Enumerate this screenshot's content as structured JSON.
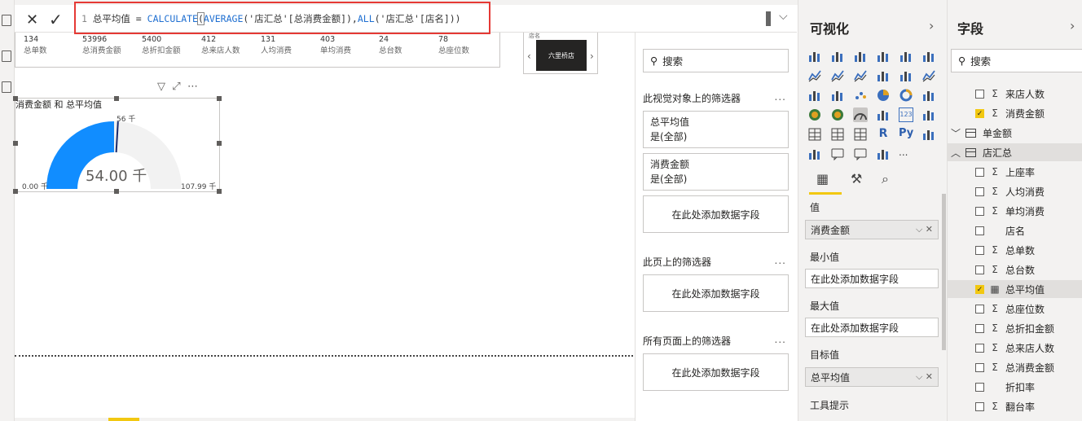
{
  "formula": {
    "line_no": "1",
    "measure": "总平均值 = ",
    "fn1": "CALCULATE",
    "fn2": "AVERAGE",
    "arg1": "('店汇总'[总消费金额]),",
    "fn3": "ALL",
    "arg2": "('店汇总'[店名]))"
  },
  "cards": [
    {
      "value": "134",
      "label": "总单数"
    },
    {
      "value": "53996",
      "label": "总消费金额"
    },
    {
      "value": "5400",
      "label": "总折扣金额"
    },
    {
      "value": "412",
      "label": "总来店人数"
    },
    {
      "value": "131",
      "label": "人均消费"
    },
    {
      "value": "403",
      "label": "单均消费"
    },
    {
      "value": "24",
      "label": "总台数"
    },
    {
      "value": "78",
      "label": "总座位数"
    }
  ],
  "slicer": {
    "caption": "店名",
    "value": "六里桥店"
  },
  "gauge": {
    "title": "消费金额 和 总平均值",
    "value_label": "54.00 千",
    "min_label": "0.00 千",
    "max_label": "107.99 千",
    "target_label": "56 千",
    "value": 54.0,
    "min": 0,
    "max": 107.99,
    "target": 56,
    "fill_color": "#118DFF",
    "track_color": "#F2F2F2"
  },
  "filters_pane": {
    "search_placeholder": "搜索",
    "section_visual": "此视觉对象上的筛选器",
    "more": "...",
    "filter1": {
      "name": "总平均值",
      "state": "是(全部)"
    },
    "filter2": {
      "name": "消费金额",
      "state": "是(全部)"
    },
    "drop_text": "在此处添加数据字段",
    "section_page": "此页上的筛选器",
    "section_all": "所有页面上的筛选器"
  },
  "viz_pane": {
    "title": "可视化",
    "more": "...",
    "value_label": "值",
    "value_field": "消费金额",
    "min_label": "最小值",
    "min_field": "在此处添加数据字段",
    "max_label": "最大值",
    "max_field": "在此处添加数据字段",
    "target_label": "目标值",
    "target_field": "总平均值",
    "tooltip_label": "工具提示",
    "icon_r": "R",
    "icon_py": "Py",
    "icon_123": "123"
  },
  "fields_pane": {
    "title": "字段",
    "search_placeholder": "搜索",
    "items": [
      {
        "label": "来店人数",
        "checked": false,
        "sigma": true,
        "indent": 1
      },
      {
        "label": "消费金额",
        "checked": true,
        "sigma": true,
        "indent": 1
      },
      {
        "label": "单金额",
        "table": true,
        "expanded": false,
        "indent": 0
      },
      {
        "label": "店汇总",
        "table": true,
        "expanded": true,
        "indent": 0
      },
      {
        "label": "上座率",
        "checked": false,
        "sigma": true,
        "indent": 1
      },
      {
        "label": "人均消费",
        "checked": false,
        "sigma": true,
        "indent": 1
      },
      {
        "label": "单均消费",
        "checked": false,
        "sigma": true,
        "indent": 1
      },
      {
        "label": "店名",
        "checked": false,
        "sigma": false,
        "indent": 1
      },
      {
        "label": "总单数",
        "checked": false,
        "sigma": true,
        "indent": 1
      },
      {
        "label": "总台数",
        "checked": false,
        "sigma": true,
        "indent": 1
      },
      {
        "label": "总平均值",
        "checked": true,
        "calc": true,
        "indent": 1
      },
      {
        "label": "总座位数",
        "checked": false,
        "sigma": true,
        "indent": 1
      },
      {
        "label": "总折扣金额",
        "checked": false,
        "sigma": true,
        "indent": 1
      },
      {
        "label": "总来店人数",
        "checked": false,
        "sigma": true,
        "indent": 1
      },
      {
        "label": "总消费金额",
        "checked": false,
        "sigma": true,
        "indent": 1
      },
      {
        "label": "折扣率",
        "checked": false,
        "sigma": false,
        "indent": 1
      },
      {
        "label": "翻台率",
        "checked": false,
        "sigma": true,
        "indent": 1
      }
    ]
  }
}
